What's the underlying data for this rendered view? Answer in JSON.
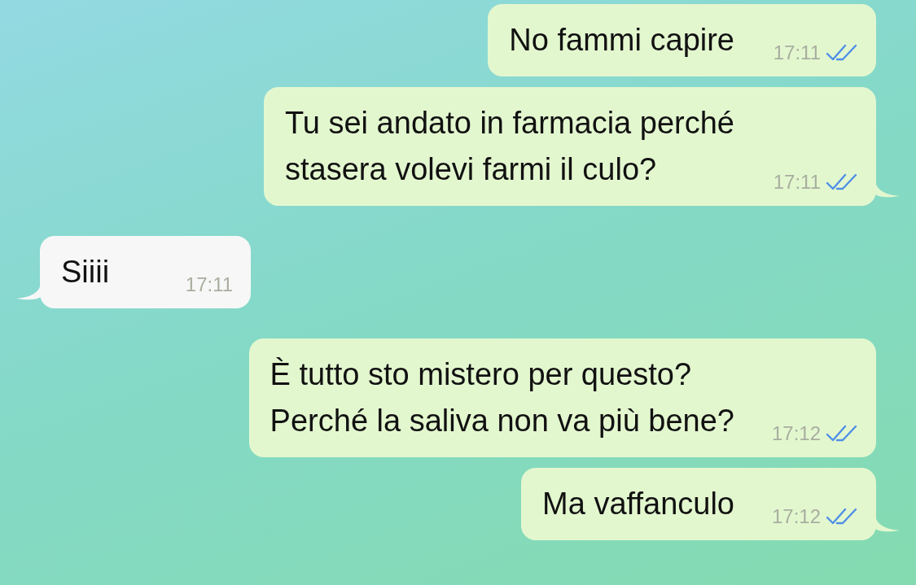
{
  "messages": [
    {
      "kind": "outgoing",
      "text": "No fammi capire",
      "time": "17:11",
      "read": true,
      "tail": false
    },
    {
      "kind": "outgoing",
      "text": "Tu sei andato in farmacia perché\nstasera volevi farmi il culo?",
      "time": "17:11",
      "read": true,
      "tail": true
    },
    {
      "kind": "incoming",
      "text": "Siiii",
      "time": "17:11",
      "tail": true
    },
    {
      "kind": "outgoing",
      "text": "È tutto sto mistero per questo?\nPerché la saliva non va più bene?",
      "time": "17:12",
      "read": true,
      "tail": false
    },
    {
      "kind": "outgoing",
      "text": "Ma vaffanculo",
      "time": "17:12",
      "read": true,
      "tail": true
    }
  ]
}
